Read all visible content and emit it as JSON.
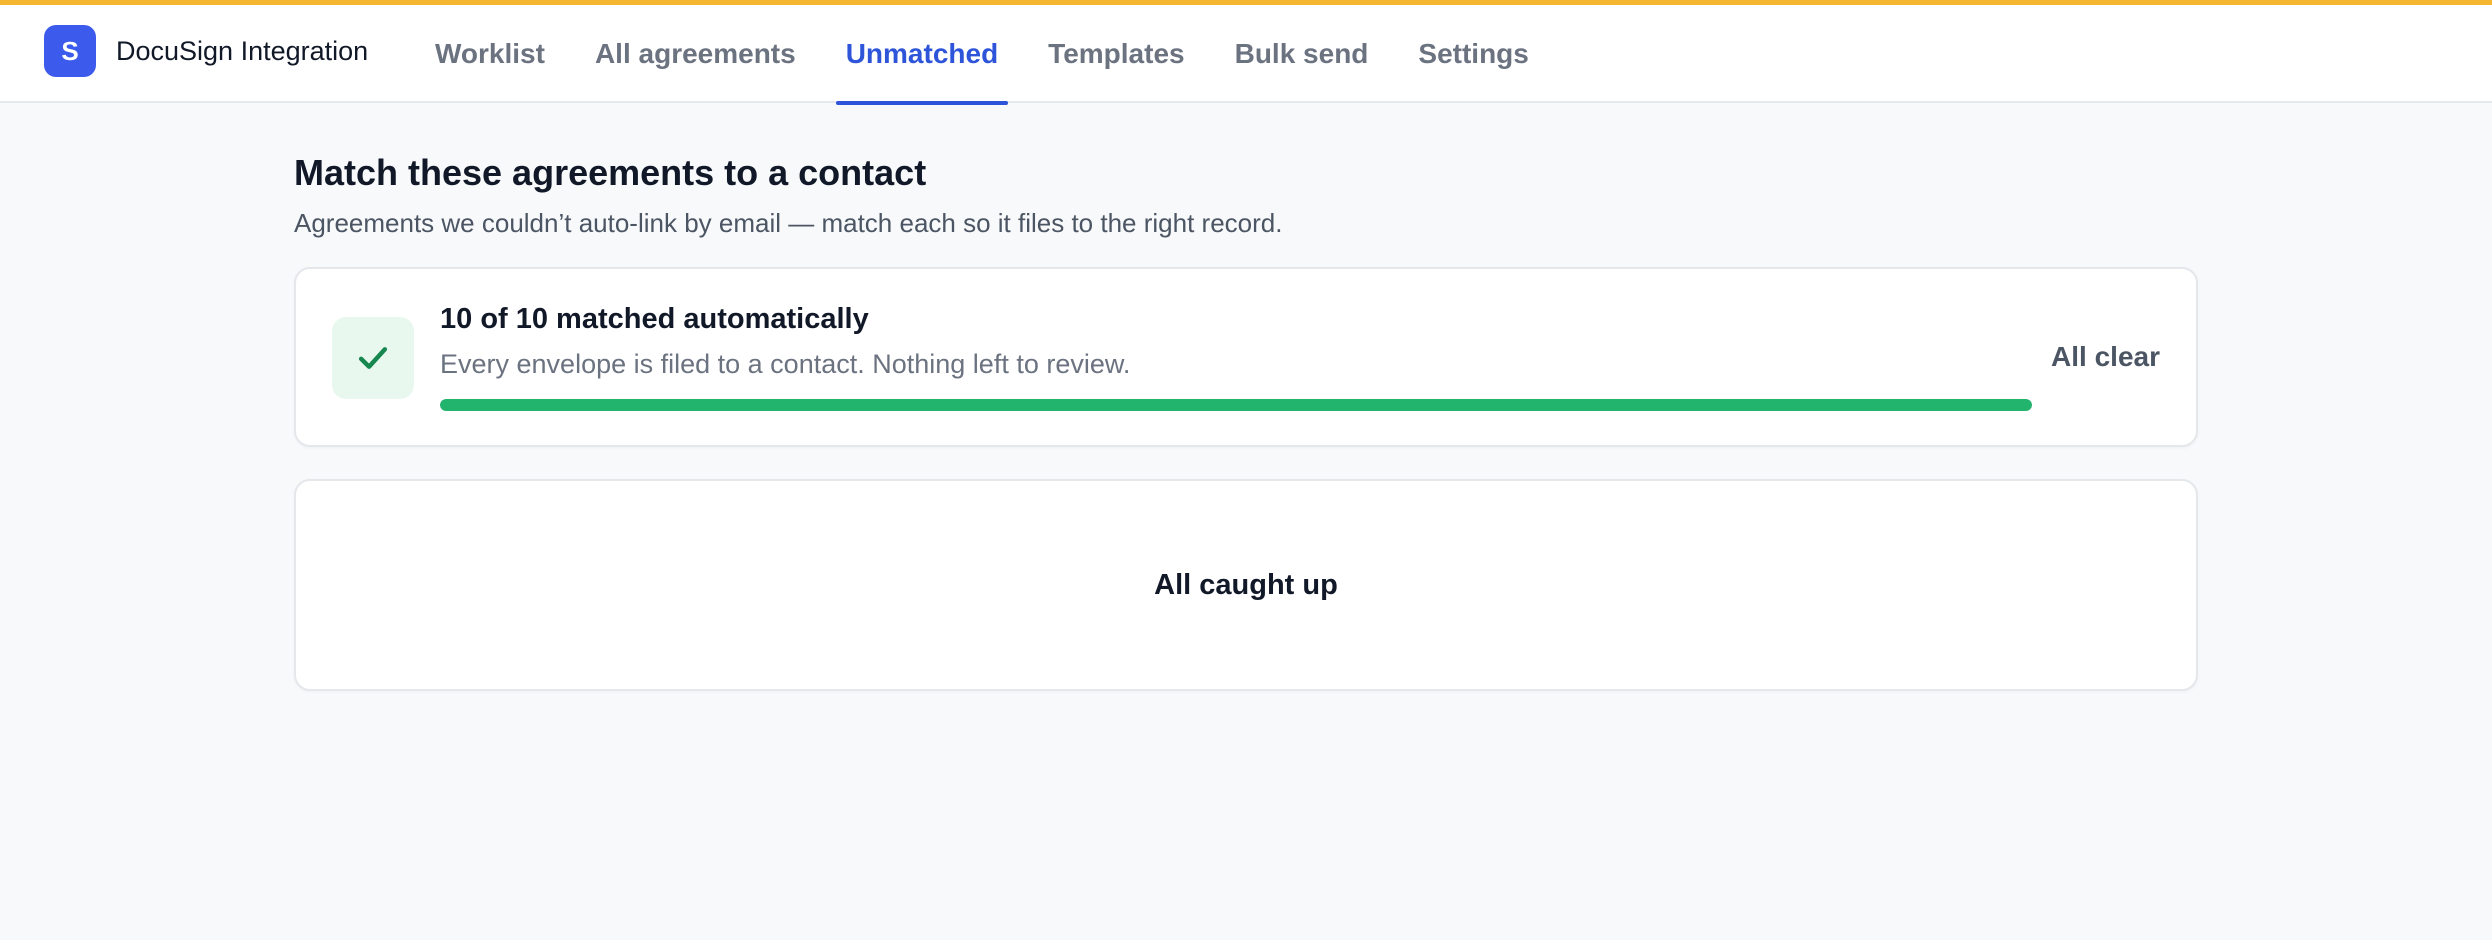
{
  "app": {
    "logo_letter": "S",
    "name": "DocuSign Integration"
  },
  "nav": {
    "tabs": [
      {
        "label": "Worklist",
        "active": false
      },
      {
        "label": "All agreements",
        "active": false
      },
      {
        "label": "Unmatched",
        "active": true
      },
      {
        "label": "Templates",
        "active": false
      },
      {
        "label": "Bulk send",
        "active": false
      },
      {
        "label": "Settings",
        "active": false
      }
    ]
  },
  "page": {
    "title": "Match these agreements to a contact",
    "subtitle": "Agreements we couldn’t auto-link by email — match each so it files to the right record."
  },
  "status": {
    "icon": "check-icon",
    "title": "10 of 10 matched automatically",
    "description": "Every envelope is filed to a contact. Nothing left to review.",
    "matched": 10,
    "total": 10,
    "progress": 1.0,
    "badge": "All clear"
  },
  "empty_state": {
    "title": "All caught up"
  },
  "colors": {
    "top_accent": "#f5b731",
    "brand": "#3c5bec",
    "active_tab": "#2d54d9",
    "progress": "#22b36c",
    "success_bg": "#e8f8ef",
    "success_icon": "#16874f"
  }
}
